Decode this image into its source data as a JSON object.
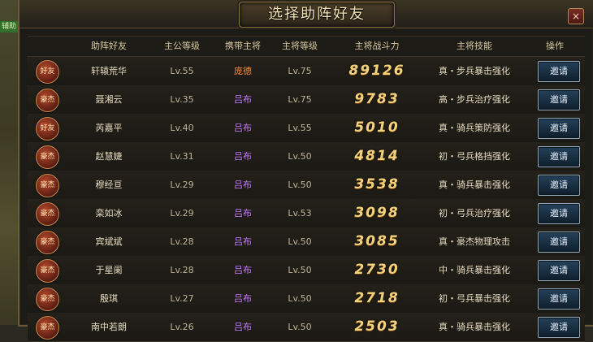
{
  "title": "选择助阵好友",
  "close_label": "×",
  "side_tag": "辅助",
  "columns": [
    "助阵好友",
    "主公等级",
    "携带主将",
    "主将等级",
    "主将战斗力",
    "主将技能",
    "操作"
  ],
  "rows": [
    {
      "badge": "好友",
      "name": "轩辕荒华",
      "level": "Lv.55",
      "general": "庞德",
      "general_color": "#ff8a3c",
      "general_level": "Lv.75",
      "power": "89126",
      "skill": "真・步兵暴击强化",
      "action": "邀请"
    },
    {
      "badge": "豪杰",
      "name": "聂湘云",
      "level": "Lv.35",
      "general": "吕布",
      "general_color": "#c77cff",
      "general_level": "Lv.75",
      "power": "9783",
      "skill": "高・步兵治疗强化",
      "action": "邀请"
    },
    {
      "badge": "好友",
      "name": "芮嘉平",
      "level": "Lv.40",
      "general": "吕布",
      "general_color": "#c77cff",
      "general_level": "Lv.55",
      "power": "5010",
      "skill": "真・骑兵策防强化",
      "action": "邀请"
    },
    {
      "badge": "豪杰",
      "name": "赵慧婕",
      "level": "Lv.31",
      "general": "吕布",
      "general_color": "#c77cff",
      "general_level": "Lv.50",
      "power": "4814",
      "skill": "初・弓兵格挡强化",
      "action": "邀请"
    },
    {
      "badge": "豪杰",
      "name": "穆经亘",
      "level": "Lv.29",
      "general": "吕布",
      "general_color": "#c77cff",
      "general_level": "Lv.50",
      "power": "3538",
      "skill": "真・骑兵暴击强化",
      "action": "邀请"
    },
    {
      "badge": "豪杰",
      "name": "栾如冰",
      "level": "Lv.29",
      "general": "吕布",
      "general_color": "#c77cff",
      "general_level": "Lv.53",
      "power": "3098",
      "skill": "初・弓兵治疗强化",
      "action": "邀请"
    },
    {
      "badge": "豪杰",
      "name": "宾斌斌",
      "level": "Lv.28",
      "general": "吕布",
      "general_color": "#c77cff",
      "general_level": "Lv.50",
      "power": "3085",
      "skill": "真・豪杰物理攻击",
      "action": "邀请"
    },
    {
      "badge": "豪杰",
      "name": "于星阑",
      "level": "Lv.28",
      "general": "吕布",
      "general_color": "#c77cff",
      "general_level": "Lv.50",
      "power": "2730",
      "skill": "中・骑兵暴击强化",
      "action": "邀请"
    },
    {
      "badge": "豪杰",
      "name": "殷琪",
      "level": "Lv.27",
      "general": "吕布",
      "general_color": "#c77cff",
      "general_level": "Lv.50",
      "power": "2718",
      "skill": "初・弓兵暴击强化",
      "action": "邀请"
    },
    {
      "badge": "豪杰",
      "name": "南中若朗",
      "level": "Lv.26",
      "general": "吕布",
      "general_color": "#c77cff",
      "general_level": "Lv.50",
      "power": "2503",
      "skill": "真・骑兵暴击强化",
      "action": "邀请"
    }
  ]
}
